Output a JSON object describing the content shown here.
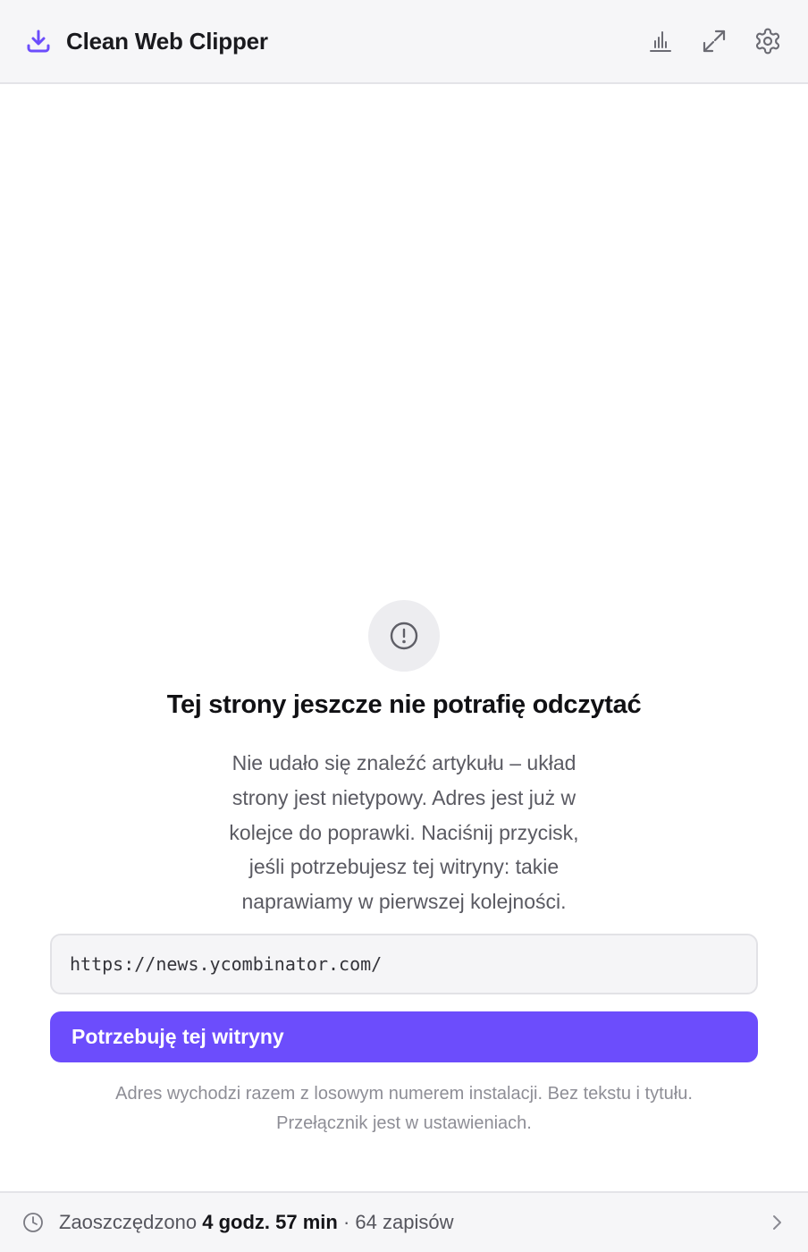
{
  "header": {
    "title": "Clean Web Clipper",
    "logo_icon": "download-icon",
    "actions": [
      {
        "name": "stats-button",
        "icon": "bar-chart-icon"
      },
      {
        "name": "expand-button",
        "icon": "expand-icon"
      },
      {
        "name": "settings-button",
        "icon": "gear-icon"
      }
    ]
  },
  "main": {
    "status_icon": "alert-circle-icon",
    "title": "Tej strony jeszcze nie potrafię odczytać",
    "description_lines": [
      "Nie udało się znaleźć artykułu – układ",
      "strony jest nietypowy. Adres jest już w",
      "kolejce do poprawki. Naciśnij przycisk,",
      "jeśli potrzebujesz tej witryny: takie",
      "naprawiamy w pierwszej kolejności."
    ],
    "url": "https://news.ycombinator.com/",
    "cta_label": "Potrzebuję tej witryny",
    "note_lines": [
      "Adres wychodzi razem z losowym numerem instalacji. Bez tekstu i tytułu.",
      "Przełącznik jest w ustawieniach."
    ]
  },
  "footer": {
    "icon": "clock-icon",
    "prefix": "Zaoszczędzono",
    "time_saved": "4 godz. 57 min",
    "separator": "·",
    "count": "64 zapisów",
    "chevron_icon": "chevron-right-icon"
  },
  "colors": {
    "accent": "#6c4dfc",
    "header_bg": "#f6f6f8",
    "icon_gray": "#6b6b73"
  }
}
